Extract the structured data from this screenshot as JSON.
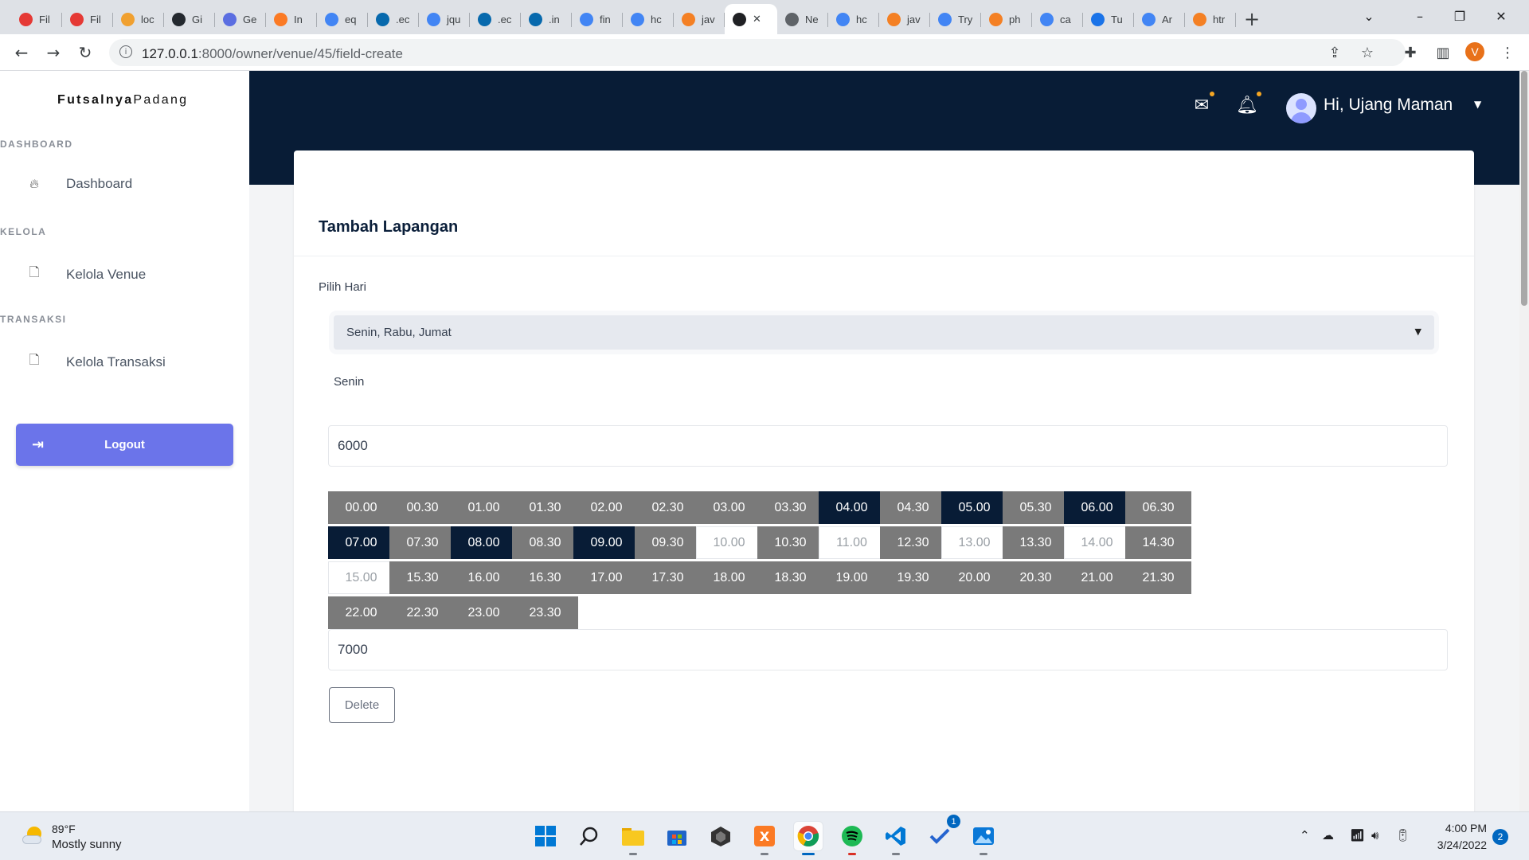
{
  "browser": {
    "tabs": [
      {
        "label": "Fil",
        "icon": "red-circle-icon",
        "color": "#e53935"
      },
      {
        "label": "Fil",
        "icon": "red-circle-icon",
        "color": "#e53935"
      },
      {
        "label": "loc",
        "icon": "php-myadmin-icon",
        "color": "#f0a030"
      },
      {
        "label": "Gi",
        "icon": "github-icon",
        "color": "#24292f"
      },
      {
        "label": "Ge",
        "icon": "stepik-icon",
        "color": "#5b6ee1"
      },
      {
        "label": "In",
        "icon": "xampp-icon",
        "color": "#fb7a24"
      },
      {
        "label": "eq",
        "icon": "google-icon",
        "color": "#4285f4"
      },
      {
        "label": ".ec",
        "icon": "jquery-icon",
        "color": "#0769ad"
      },
      {
        "label": "jqu",
        "icon": "google-icon",
        "color": "#4285f4"
      },
      {
        "label": ".ec",
        "icon": "jquery-icon",
        "color": "#0769ad"
      },
      {
        "label": ".in",
        "icon": "jquery-icon",
        "color": "#0769ad"
      },
      {
        "label": "fin",
        "icon": "google-icon",
        "color": "#4285f4"
      },
      {
        "label": "hc",
        "icon": "google-icon",
        "color": "#4285f4"
      },
      {
        "label": "jav",
        "icon": "stackoverflow-icon",
        "color": "#f48024"
      },
      {
        "label": "",
        "icon": "globe-icon",
        "color": "#202124",
        "active": true
      },
      {
        "label": "Ne",
        "icon": "github-icon",
        "color": "#5f6368"
      },
      {
        "label": "hc",
        "icon": "google-icon",
        "color": "#4285f4"
      },
      {
        "label": "jav",
        "icon": "stackoverflow-icon",
        "color": "#f48024"
      },
      {
        "label": "Try",
        "icon": "google-icon",
        "color": "#4285f4"
      },
      {
        "label": "ph",
        "icon": "stackoverflow-icon",
        "color": "#f48024"
      },
      {
        "label": "ca",
        "icon": "google-icon",
        "color": "#4285f4"
      },
      {
        "label": "Tu",
        "icon": "diamond-icon",
        "color": "#1a73e8"
      },
      {
        "label": "Ar",
        "icon": "google-icon",
        "color": "#4285f4"
      },
      {
        "label": "htr",
        "icon": "stackoverflow-icon",
        "color": "#f48024"
      }
    ],
    "url_host": "127.0.0.1",
    "url_path": ":8000/owner/venue/45/field-create",
    "profile_initial": "V"
  },
  "app": {
    "brand_part1": "Futsalnya",
    "brand_part2": "Padang",
    "sections": [
      {
        "heading": "DASHBOARD",
        "item": "Dashboard",
        "icon": "fire-icon"
      },
      {
        "heading": "KELOLA",
        "item": "Kelola Venue",
        "icon": "file-icon"
      },
      {
        "heading": "TRANSAKSI",
        "item": "Kelola Transaksi",
        "icon": "file-icon"
      }
    ],
    "logout_label": "Logout",
    "user_greeting": "Hi, Ujang Maman"
  },
  "form": {
    "title": "Tambah Lapangan",
    "day_label": "Pilih Hari",
    "day_selected": "Senin, Rabu, Jumat",
    "day_name": "Senin",
    "price_1": "6000",
    "price_2": "7000",
    "delete_label": "Delete",
    "slots": [
      {
        "time": "00.00",
        "state": "normal"
      },
      {
        "time": "00.30",
        "state": "normal"
      },
      {
        "time": "01.00",
        "state": "normal"
      },
      {
        "time": "01.30",
        "state": "normal"
      },
      {
        "time": "02.00",
        "state": "normal"
      },
      {
        "time": "02.30",
        "state": "normal"
      },
      {
        "time": "03.00",
        "state": "normal"
      },
      {
        "time": "03.30",
        "state": "normal"
      },
      {
        "time": "04.00",
        "state": "selected"
      },
      {
        "time": "04.30",
        "state": "normal"
      },
      {
        "time": "05.00",
        "state": "selected"
      },
      {
        "time": "05.30",
        "state": "normal"
      },
      {
        "time": "06.00",
        "state": "selected"
      },
      {
        "time": "06.30",
        "state": "normal"
      },
      {
        "time": "07.00",
        "state": "selected"
      },
      {
        "time": "07.30",
        "state": "normal"
      },
      {
        "time": "08.00",
        "state": "selected"
      },
      {
        "time": "08.30",
        "state": "normal"
      },
      {
        "time": "09.00",
        "state": "selected"
      },
      {
        "time": "09.30",
        "state": "normal"
      },
      {
        "time": "10.00",
        "state": "booked"
      },
      {
        "time": "10.30",
        "state": "normal"
      },
      {
        "time": "11.00",
        "state": "booked"
      },
      {
        "time": "12.30",
        "state": "normal"
      },
      {
        "time": "13.00",
        "state": "booked"
      },
      {
        "time": "13.30",
        "state": "normal"
      },
      {
        "time": "14.00",
        "state": "booked"
      },
      {
        "time": "14.30",
        "state": "normal"
      },
      {
        "time": "15.00",
        "state": "booked"
      },
      {
        "time": "15.30",
        "state": "normal"
      },
      {
        "time": "16.00",
        "state": "normal"
      },
      {
        "time": "16.30",
        "state": "normal"
      },
      {
        "time": "17.00",
        "state": "normal"
      },
      {
        "time": "17.30",
        "state": "normal"
      },
      {
        "time": "18.00",
        "state": "normal"
      },
      {
        "time": "18.30",
        "state": "normal"
      },
      {
        "time": "19.00",
        "state": "normal"
      },
      {
        "time": "19.30",
        "state": "normal"
      },
      {
        "time": "20.00",
        "state": "normal"
      },
      {
        "time": "20.30",
        "state": "normal"
      },
      {
        "time": "21.00",
        "state": "normal"
      },
      {
        "time": "21.30",
        "state": "normal"
      },
      {
        "time": "22.00",
        "state": "normal"
      },
      {
        "time": "22.30",
        "state": "normal"
      },
      {
        "time": "23.00",
        "state": "normal"
      },
      {
        "time": "23.30",
        "state": "normal"
      }
    ]
  },
  "taskbar": {
    "weather_temp": "89°F",
    "weather_desc": "Mostly sunny",
    "apps": [
      "start-icon",
      "search-icon",
      "file-explorer-icon",
      "store-icon",
      "unity-icon",
      "xampp-icon",
      "chrome-icon",
      "spotify-icon",
      "vscode-icon",
      "todo-icon",
      "photos-icon"
    ],
    "todo_badge": "1",
    "clock_time": "4:00 PM",
    "clock_date": "3/24/2022",
    "notification_count": "2"
  },
  "colors": {
    "navy": "#081c36",
    "slot_gray": "#7a7a7a",
    "accent": "#6b74ea"
  }
}
